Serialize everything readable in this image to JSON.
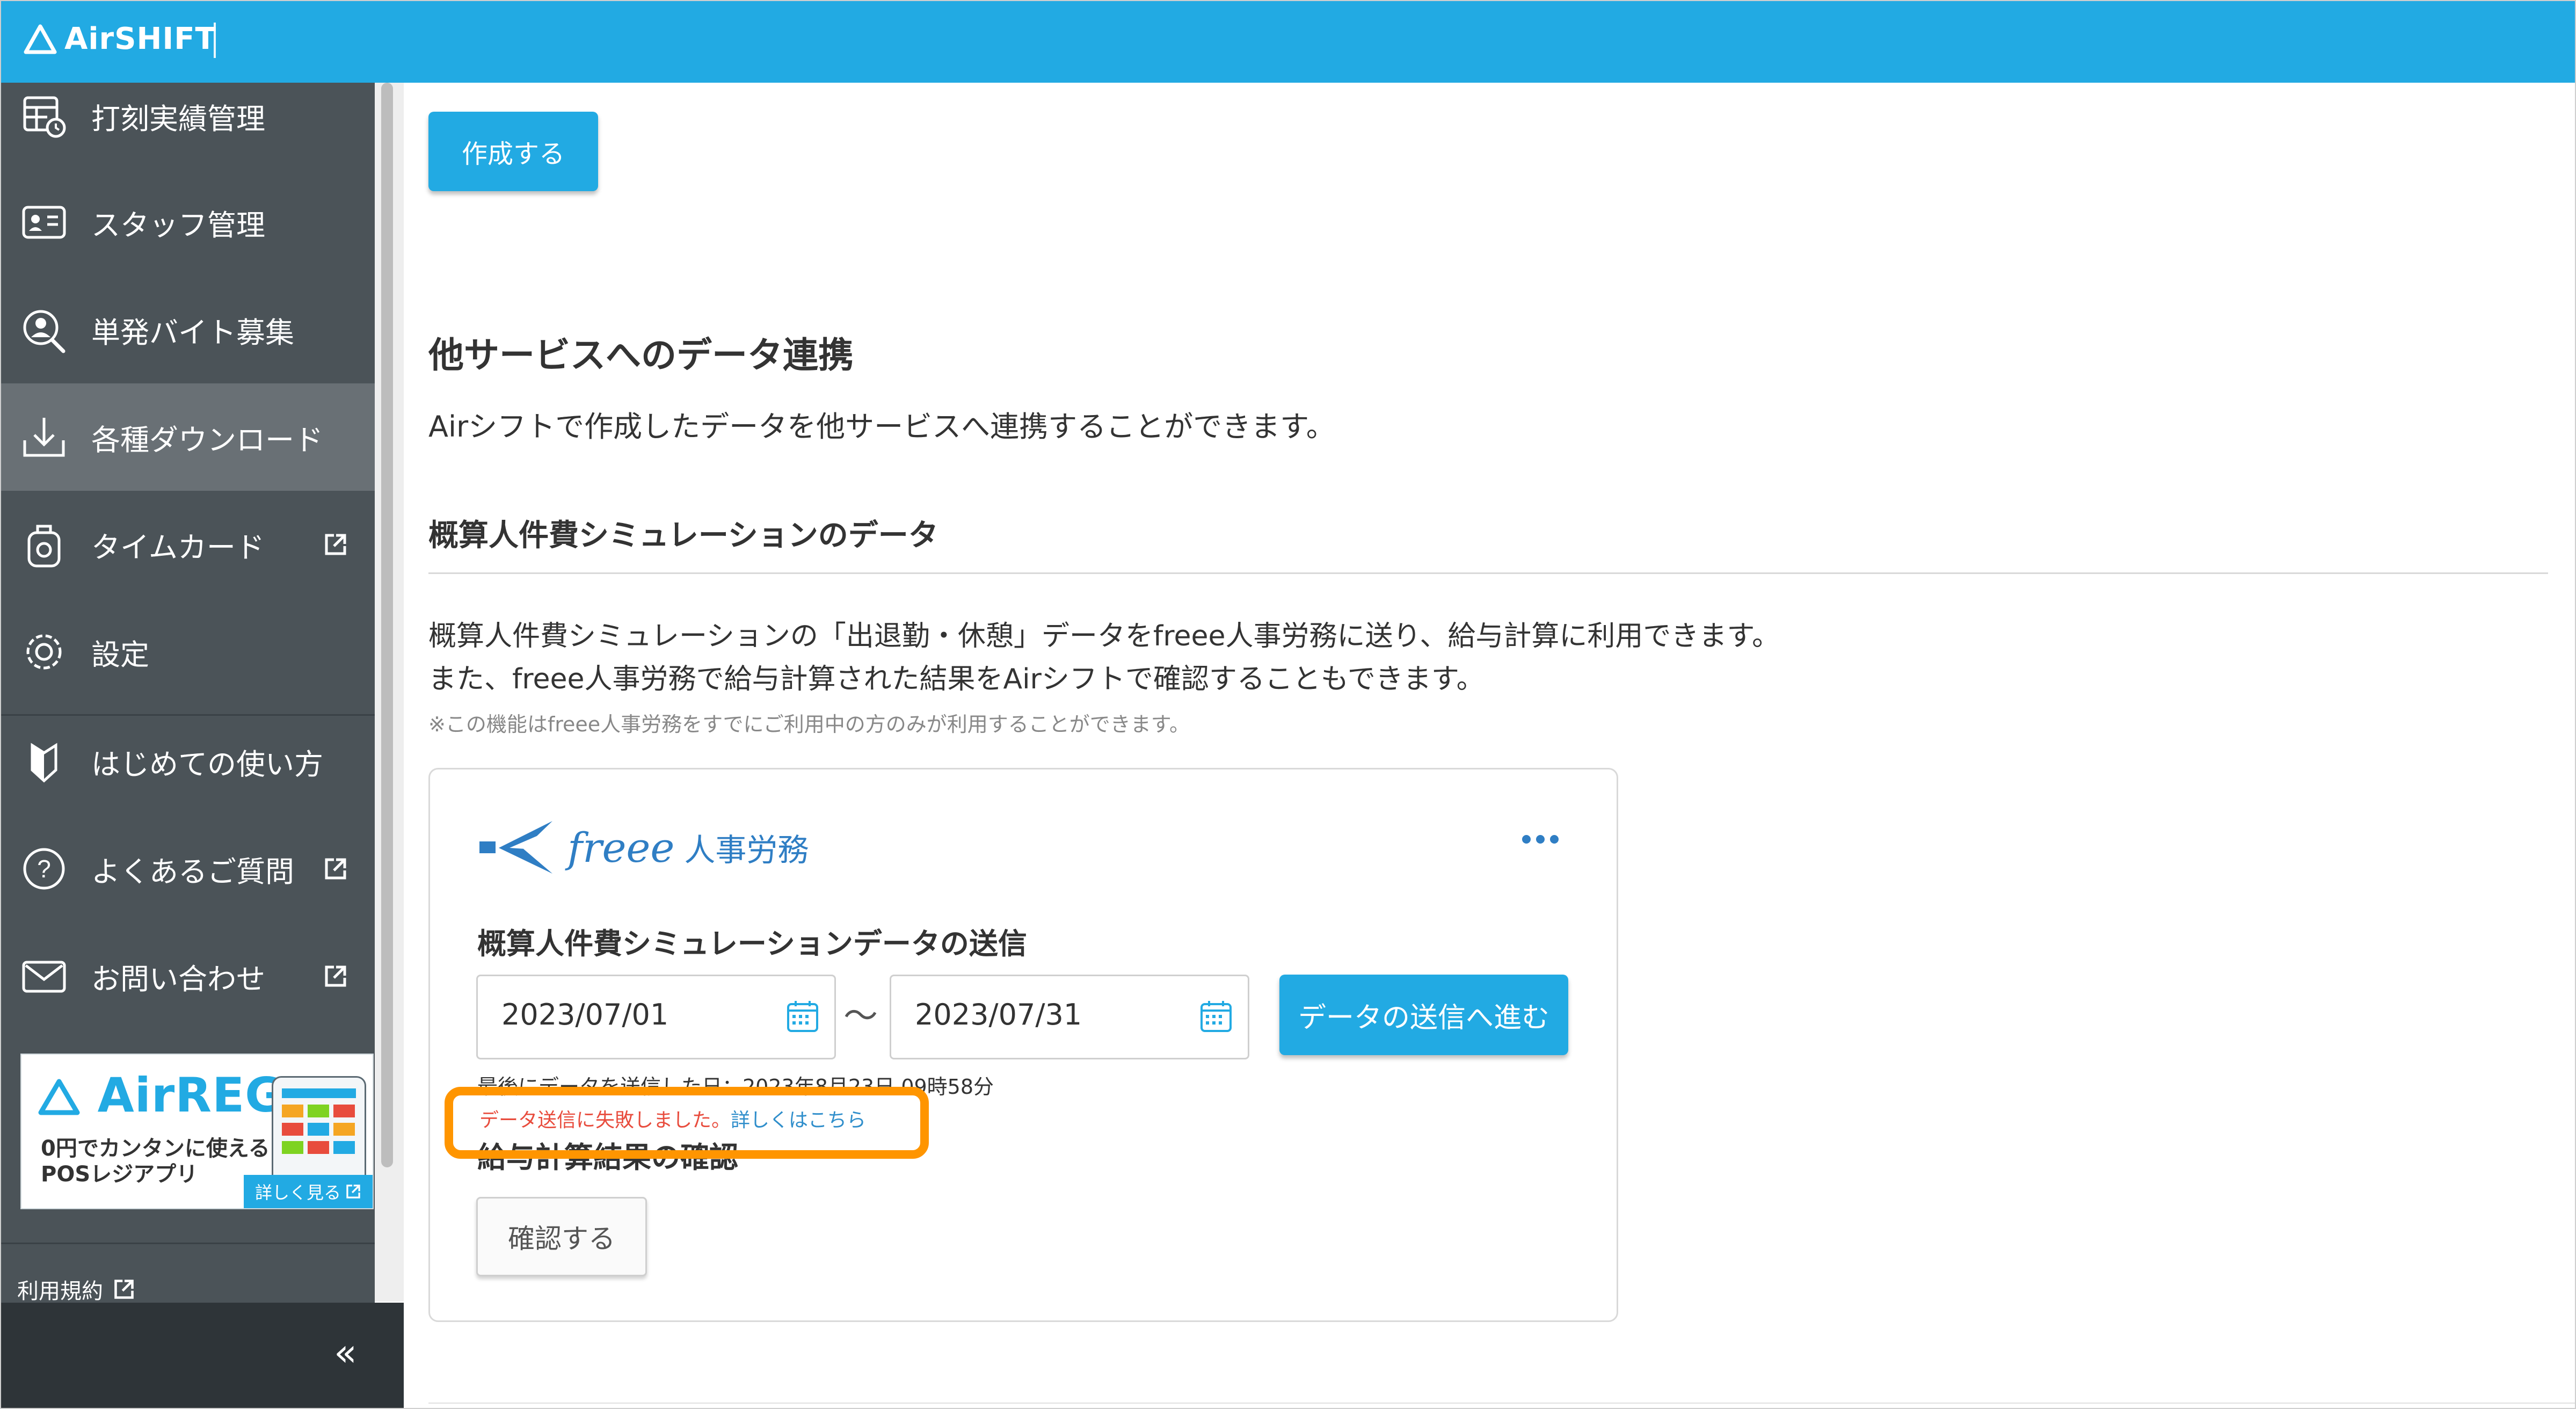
{
  "header": {
    "app_name": "AirSHIFT",
    "brand_color": "#22aae3"
  },
  "sidebar": {
    "items": [
      {
        "label": "打刻実績管理",
        "icon": "timesheet-icon",
        "external": false,
        "active": false
      },
      {
        "label": "スタッフ管理",
        "icon": "staff-card-icon",
        "external": false,
        "active": false
      },
      {
        "label": "単発バイト募集",
        "icon": "person-search-icon",
        "external": false,
        "active": false
      },
      {
        "label": "各種ダウンロード",
        "icon": "download-icon",
        "external": false,
        "active": true
      },
      {
        "label": "タイムカード",
        "icon": "timecard-icon",
        "external": true,
        "active": false
      },
      {
        "label": "設定",
        "icon": "gear-icon",
        "external": false,
        "active": false
      },
      {
        "label": "はじめての使い方",
        "icon": "beginner-icon",
        "external": false,
        "active": false
      },
      {
        "label": "よくあるご質問",
        "icon": "question-icon",
        "external": true,
        "active": false
      },
      {
        "label": "お問い合わせ",
        "icon": "mail-icon",
        "external": true,
        "active": false
      }
    ],
    "ad": {
      "logo": "AirREGI",
      "line1": "0円でカンタンに使える",
      "line2": "POSレジアプリ",
      "button": "詳しく見る"
    },
    "terms_label": "利用規約",
    "collapse_label": "«"
  },
  "main": {
    "create_button": "作成する",
    "section_title": "他サービスへのデータ連携",
    "section_desc": "Airシフトで作成したデータを他サービスへ連携することができます。",
    "sub_title": "概算人件費シミュレーションのデータ",
    "para1": "概算人件費シミュレーションの「出退勤・休憩」データをfreee人事労務に送り、給与計算に利用できます。",
    "para2": "また、freee人事労務で給与計算された結果をAirシフトで確認することもできます。",
    "note": "※この機能はfreee人事労務をすでにご利用中の方のみが利用することができます。",
    "card": {
      "logo_word": "freee",
      "logo_jp": "人事労務",
      "send_title": "概算人件費シミュレーションデータの送信",
      "date_from": "2023/07/01",
      "date_sep": "〜",
      "date_to": "2023/07/31",
      "send_button": "データの送信へ進む",
      "last_sent": "最後にデータを送信した日：2023年8月23日 09時58分",
      "error_text": "データ送信に失敗しました。",
      "error_link": "詳しくはこちら",
      "result_title": "給与計算結果の確認",
      "confirm_button": "確認する"
    }
  },
  "colors": {
    "sidebar_bg": "#4b5358",
    "sidebar_active": "#697075",
    "error": "#e84c3d",
    "link": "#2f8ecb",
    "highlight": "#ff9500"
  }
}
